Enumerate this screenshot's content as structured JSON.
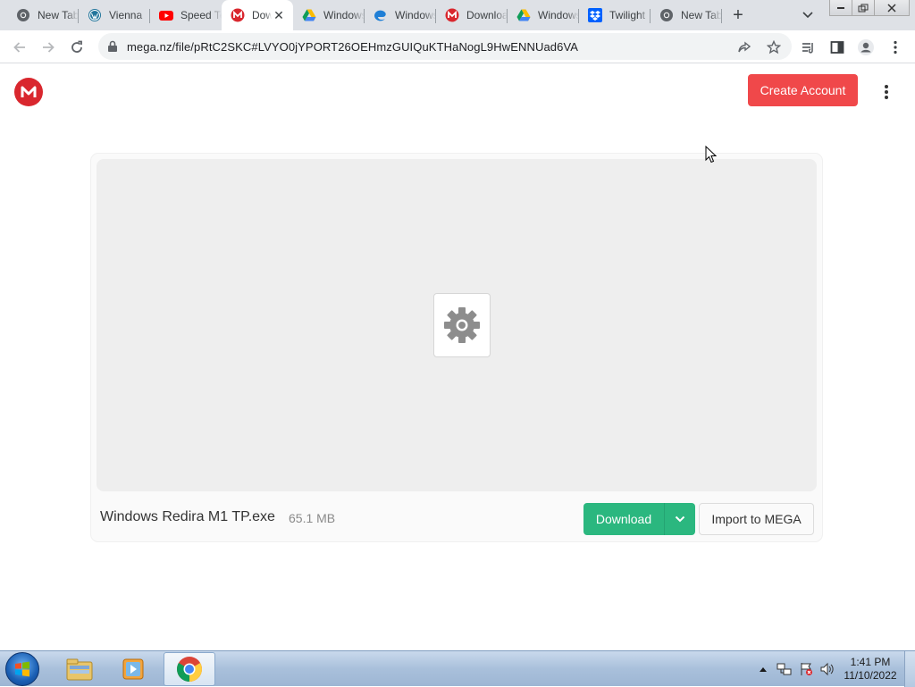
{
  "browser": {
    "tabs": [
      {
        "title": "New Tab",
        "icon": "chrome-icon",
        "active": false
      },
      {
        "title": "Vienna",
        "icon": "wordpress-icon",
        "active": false
      },
      {
        "title": "Speed Test",
        "icon": "youtube-icon",
        "active": false
      },
      {
        "title": "Download",
        "icon": "mega-icon",
        "active": true
      },
      {
        "title": "Windows",
        "icon": "google-drive-icon",
        "active": false
      },
      {
        "title": "Windows",
        "icon": "edge-icon",
        "active": false
      },
      {
        "title": "Download",
        "icon": "mega-icon",
        "active": false
      },
      {
        "title": "Windows",
        "icon": "google-drive-icon",
        "active": false
      },
      {
        "title": "Twilight",
        "icon": "dropbox-icon",
        "active": false
      },
      {
        "title": "New Tab",
        "icon": "chrome-icon",
        "active": false
      }
    ],
    "url": "mega.nz/file/pRtC2SKC#LVYO0jYPORT26OEHmzGUIQuKTHaNogL9HwENNUad6VA"
  },
  "page": {
    "create_account_label": "Create Account",
    "file": {
      "name": "Windows Redira M1 TP.exe",
      "size": "65.1 MB",
      "icon": "gear-icon"
    },
    "download_label": "Download",
    "import_label": "Import to MEGA"
  },
  "taskbar": {
    "apps": [
      "windows-explorer-icon",
      "media-player-icon",
      "chrome-icon"
    ],
    "clock_time": "1:41 PM",
    "clock_date": "11/10/2022"
  },
  "colors": {
    "mega_red": "#d9272e",
    "create_button": "#f0484a",
    "download_button": "#2bb77f"
  }
}
